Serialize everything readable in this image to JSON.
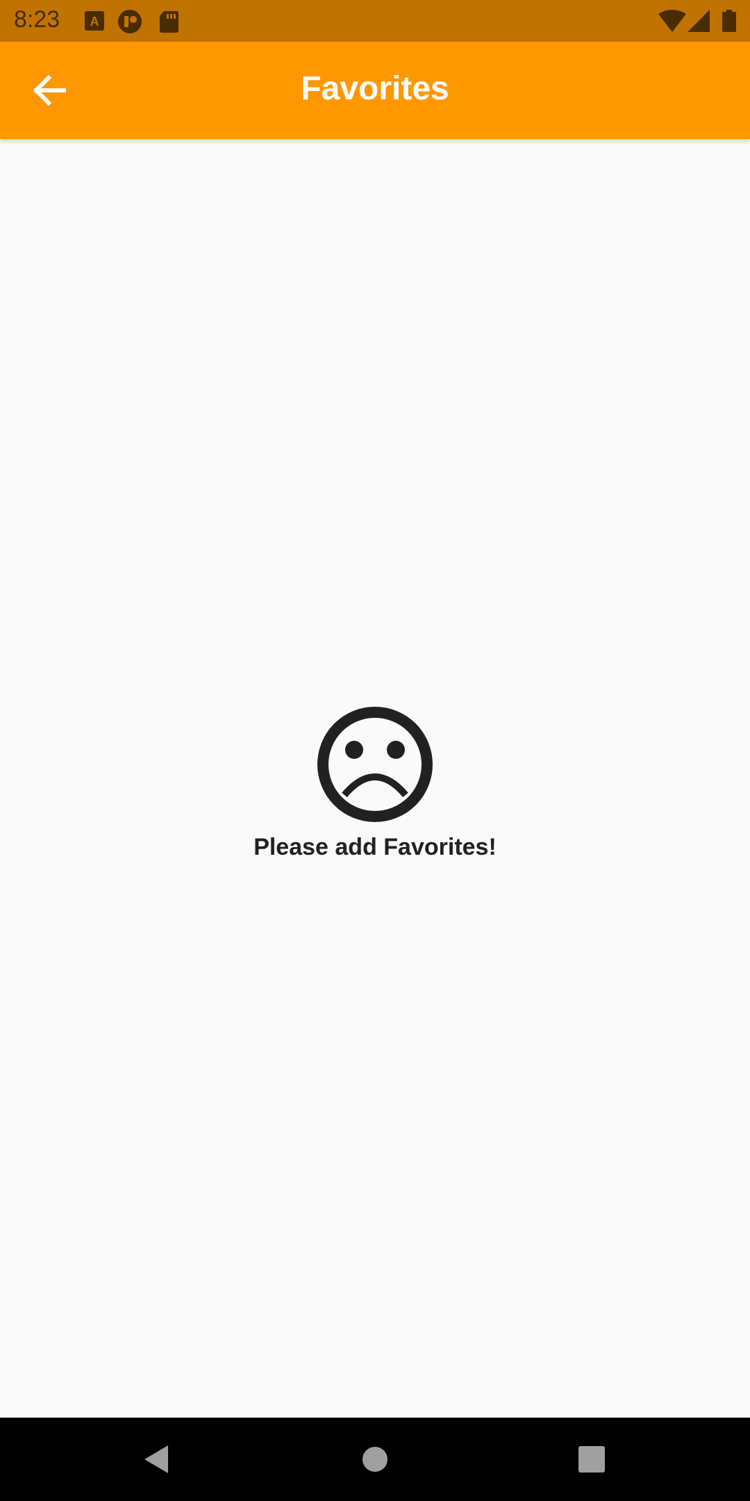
{
  "status_bar": {
    "time": "8:23",
    "left_icons": [
      "a-icon",
      "assistant-icon",
      "sd-card-icon"
    ],
    "right_icons": [
      "wifi-icon",
      "signal-icon",
      "battery-icon"
    ],
    "background": "#c17300"
  },
  "app_bar": {
    "title": "Favorites",
    "back_icon": "arrow-back-icon",
    "background": "#ff9800"
  },
  "empty_state": {
    "icon": "sad-face-icon",
    "message": "Please add Favorites!"
  },
  "nav_bar": {
    "buttons": [
      "back-triangle-icon",
      "home-circle-icon",
      "recents-square-icon"
    ]
  }
}
